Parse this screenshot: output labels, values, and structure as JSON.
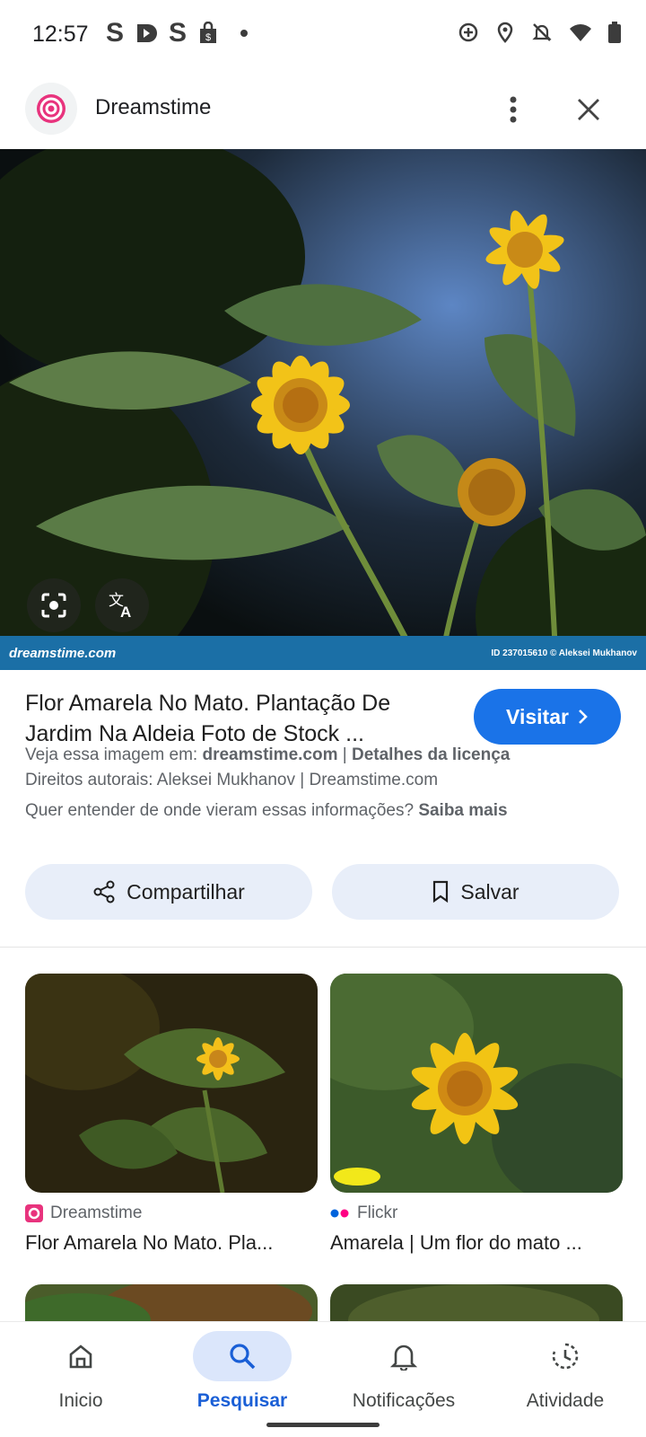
{
  "status_bar": {
    "time": "12:57",
    "left_icons": [
      "S",
      "S"
    ]
  },
  "header": {
    "site_name": "Dreamstime"
  },
  "hero": {
    "credit_logo": "dreamstime.com",
    "credit_id": "ID 237015610 © Aleksei Mukhanov"
  },
  "result": {
    "title": "Flor Amarela No Mato. Plantação De Jardim Na Aldeia Foto de Stock ...",
    "visit_label": "Visitar",
    "see_image_prefix": "Veja essa imagem em: ",
    "see_image_site": "dreamstime.com",
    "separator": " | ",
    "license_details": "Detalhes da licença",
    "copyright": "Direitos autorais: Aleksei Mukhanov | Dreamstime.com",
    "info_question": "Quer entender de onde vieram essas informações? ",
    "learn_more": "Saiba mais"
  },
  "actions": {
    "share_label": "Compartilhar",
    "save_label": "Salvar"
  },
  "related": [
    {
      "source": "Dreamstime",
      "title": "Flor Amarela No Mato. Pla..."
    },
    {
      "source": "Flickr",
      "title": "Amarela | Um flor do mato ..."
    }
  ],
  "bottom_nav": [
    {
      "label": "Inicio"
    },
    {
      "label": "Pesquisar"
    },
    {
      "label": "Notificações"
    },
    {
      "label": "Atividade"
    }
  ],
  "colors": {
    "accent": "#1a73e8",
    "active_nav": "#1a5fd6",
    "pill_bg": "#e8eef9"
  }
}
